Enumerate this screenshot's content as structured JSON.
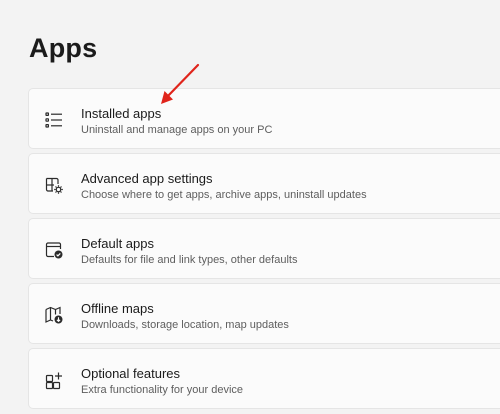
{
  "page": {
    "title": "Apps"
  },
  "items": [
    {
      "title": "Installed apps",
      "description": "Uninstall and manage apps on your PC",
      "icon": "list-icon"
    },
    {
      "title": "Advanced app settings",
      "description": "Choose where to get apps, archive apps, uninstall updates",
      "icon": "apps-settings-icon"
    },
    {
      "title": "Default apps",
      "description": "Defaults for file and link types, other defaults",
      "icon": "default-apps-icon"
    },
    {
      "title": "Offline maps",
      "description": "Downloads, storage location, map updates",
      "icon": "map-download-icon"
    },
    {
      "title": "Optional features",
      "description": "Extra functionality for your device",
      "icon": "apps-add-icon"
    }
  ],
  "colors": {
    "background": "#f3f3f3",
    "card": "#fbfbfb",
    "annotation_arrow": "#e0241b"
  }
}
